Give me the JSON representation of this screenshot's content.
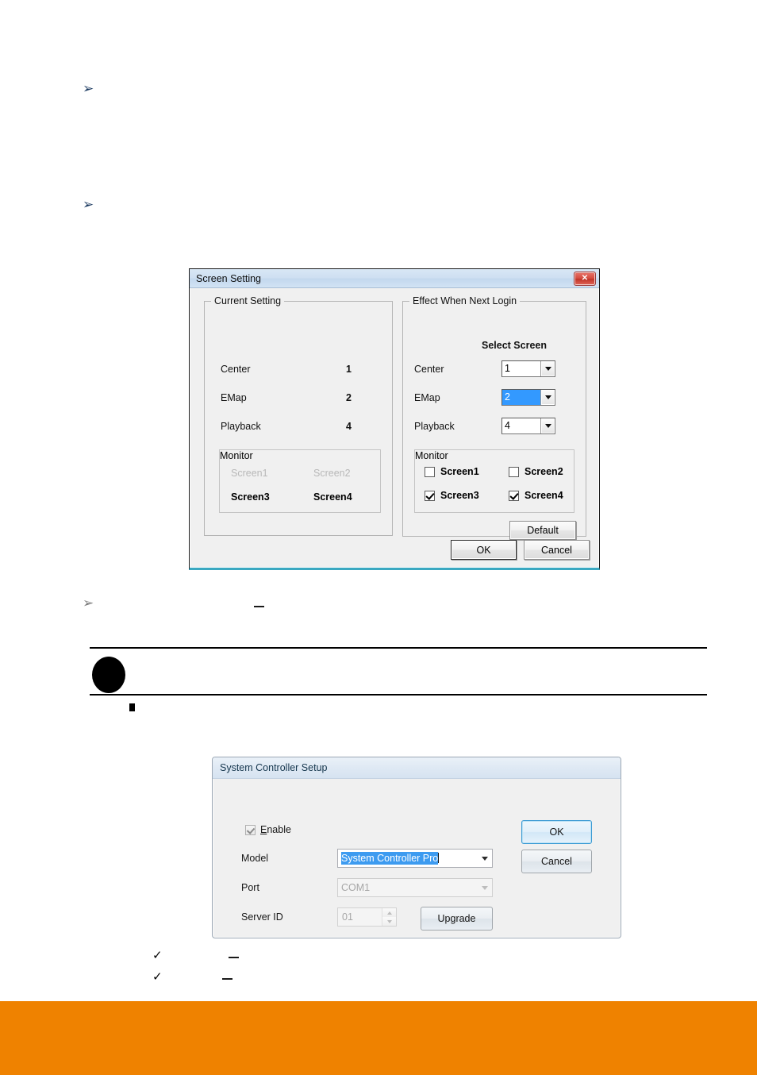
{
  "page": {
    "footer_color": "#ef8200",
    "note": {
      "circle_present": true,
      "square_bullet_present": true
    },
    "bullets": [
      {
        "glyph": "➢",
        "name": "arrow-bullet-1"
      },
      {
        "glyph": "➢",
        "name": "arrow-bullet-2"
      },
      {
        "glyph": "➢",
        "name": "arrow-bullet-3"
      },
      {
        "glyph": "✓",
        "name": "check-bullet-1"
      },
      {
        "glyph": "✓",
        "name": "check-bullet-2"
      }
    ]
  },
  "screen_setting_dialog": {
    "title": "Screen Setting",
    "close_glyph": "✕",
    "current_setting": {
      "legend": "Current Setting",
      "rows": [
        {
          "label": "Center",
          "value": "1"
        },
        {
          "label": "EMap",
          "value": "2"
        },
        {
          "label": "Playback",
          "value": "4"
        }
      ],
      "monitor": {
        "legend": "Monitor",
        "screens": [
          {
            "label": "Screen1",
            "enabled": false
          },
          {
            "label": "Screen2",
            "enabled": false
          },
          {
            "label": "Screen3",
            "enabled": true
          },
          {
            "label": "Screen4",
            "enabled": true
          }
        ]
      }
    },
    "effect_next_login": {
      "legend": "Effect When Next Login",
      "select_screen_header": "Select Screen",
      "rows": [
        {
          "label": "Center",
          "value": "1",
          "selected": false
        },
        {
          "label": "EMap",
          "value": "2",
          "selected": true
        },
        {
          "label": "Playback",
          "value": "4",
          "selected": false
        }
      ],
      "monitor": {
        "legend": "Monitor",
        "checkboxes": [
          {
            "label": "Screen1",
            "checked": false
          },
          {
            "label": "Screen2",
            "checked": false
          },
          {
            "label": "Screen3",
            "checked": true
          },
          {
            "label": "Screen4",
            "checked": true
          }
        ]
      },
      "default_button": "Default"
    },
    "ok_button": "OK",
    "cancel_button": "Cancel",
    "highlight_color": "#3399ff"
  },
  "system_controller_dialog": {
    "title": "System Controller Setup",
    "enable": {
      "label_prefix": "",
      "label_mnemonic": "E",
      "label_rest": "nable",
      "checked": true
    },
    "fields": [
      {
        "label": "Model",
        "value": "System Controller Pro",
        "disabled": false,
        "selected": true
      },
      {
        "label": "Port",
        "value": "COM1",
        "disabled": true,
        "selected": false
      },
      {
        "label": "Server ID",
        "value": "01",
        "disabled": true,
        "selected": false
      }
    ],
    "ok_button": "OK",
    "cancel_button": "Cancel",
    "upgrade_button": "Upgrade",
    "highlight_color": "#3d9bf0"
  }
}
